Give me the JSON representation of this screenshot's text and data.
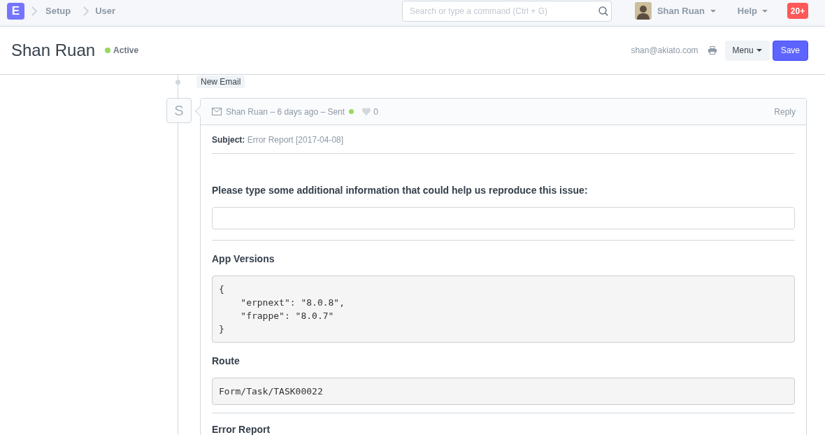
{
  "navbar": {
    "logo": "E",
    "breadcrumbs": [
      {
        "label": "Setup"
      },
      {
        "label": "User"
      }
    ],
    "search": {
      "placeholder": "Search or type a command (Ctrl + G)"
    },
    "user_menu": {
      "name": "Shan Ruan"
    },
    "help_menu": {
      "label": "Help"
    },
    "notifications": {
      "count": "20+"
    }
  },
  "page_header": {
    "title": "Shan Ruan",
    "status": "Active",
    "email": "shan@akiato.com",
    "buttons": [
      {
        "kind": "menu",
        "label": "Menu"
      },
      {
        "kind": "primary",
        "label": "Save"
      }
    ]
  },
  "timeline": [
    {
      "kind": "event",
      "label": "New Email"
    },
    {
      "kind": "communication",
      "avatar": "S",
      "meta": "Shan Ruan – 6 days ago – Sent",
      "likes": "0",
      "reply": "Reply",
      "subject": "**Subject:** Error Report [2017-04-08]",
      "sections": [
        {
          "kind": "text_input",
          "heading": "Please type some additional information that could help us reproduce this issue:",
          "divider_after": true
        },
        {
          "kind": "code",
          "heading": "App Versions",
          "code": "{\n\t\"erpnext\": \"8.0.8\",\n\t\"frappe\": \"8.0.7\"\n}",
          "divider_after": false
        },
        {
          "kind": "code",
          "heading": "Route",
          "code": "Form/Task/TASK00022",
          "divider_after": true
        },
        {
          "kind": "heading",
          "heading": "Error Report",
          "divider_after": false
        }
      ]
    }
  ]
}
